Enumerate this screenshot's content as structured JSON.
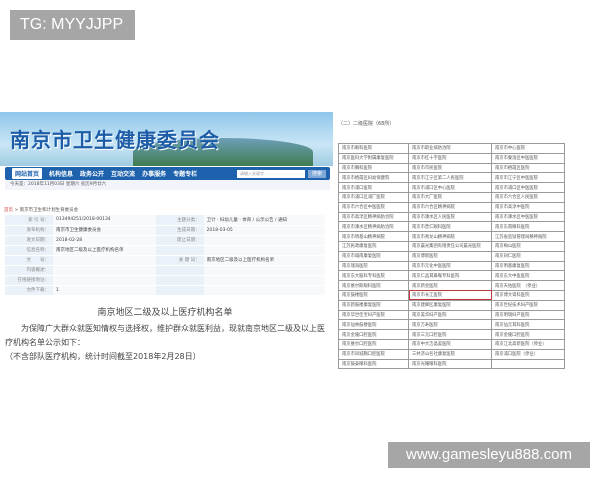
{
  "watermark_top": "TG: MYYJJPP",
  "watermark_bottom": "www.gamesleyu888.com",
  "site": {
    "title": "南京市卫生健康委员会",
    "nav": [
      "网站首页",
      "机构信息",
      "政务公开",
      "互动交流",
      "办事服务",
      "专题专栏"
    ],
    "search_placeholder": "请输入关键字",
    "search_button": "搜索",
    "dateline": "今天是：2018年11月03日  星期六      农历9月廿六",
    "breadcrumb_home": "首页",
    "breadcrumb_sep": ">",
    "breadcrumb_current": "南京市卫生和计划生育委员会",
    "meta": [
      {
        "k1": "索 引 号：",
        "v1": "013494251/2018-00134",
        "k2": "主题分类：",
        "v2": "卫计 · 妇幼儿童 · 体育 / 公示公告 / 通知"
      },
      {
        "k1": "发布机构：",
        "v1": "南京市卫生健康委员会",
        "k2": "生成日期：",
        "v2": "2018-03-05"
      },
      {
        "k1": "发文日期：",
        "v1": "2018-02-28",
        "k2": "废止日期：",
        "v2": ""
      },
      {
        "k1": "信息名称：",
        "v1": "南京地区二级及以上医疗机构名单",
        "k2": "",
        "v2": ""
      },
      {
        "k1": "文　　号：",
        "v1": "",
        "k2": "关 键 词：",
        "v2": "南京地区二级及以上医疗机构名单"
      },
      {
        "k1": "内容概述：",
        "v1": "",
        "k2": "",
        "v2": ""
      },
      {
        "k1": "在线链接地址：",
        "v1": "",
        "k2": "",
        "v2": ""
      },
      {
        "k1": "文件下载：",
        "v1": "1",
        "k2": "",
        "v2": ""
      }
    ],
    "content_title": "南京地区二级及以上医疗机构名单",
    "content_p1": "为保障广大群众就医知情权与选择权，维护群众就医利益，现就南京地区二级及以上医疗机构名单公示如下：",
    "content_p2": "（不含部队医疗机构，统计时间截至2018年2月28日）"
  },
  "hospital_list": {
    "caption": "（二）二级医院（68所）",
    "highlight_color": "#c0383c",
    "rows": [
      [
        "南京市眼科医院",
        "南京市职业病防治院",
        "南京市中心医院"
      ],
      [
        "南京医科大学附属康复医院",
        "南京市红十字医院",
        "南京市秦淮区中医医院"
      ],
      [
        "南京市胸科医院",
        "南京市市民医院",
        "南京市栖霞区医院"
      ],
      [
        "南京市栖霞区妇幼保健院",
        "南京市江宁区第二人民医院",
        "南京市江宁区中医医院"
      ],
      [
        "南京市浦口医院",
        "南京市浦口区中心医院",
        "南京市浦口区中医医院"
      ],
      [
        "南京市浦口区浦厂医院",
        "南京市大厂医院",
        "南京市六合区人民医院"
      ],
      [
        "南京市六合区中医医院",
        "南京市六合区精神病院",
        "南京市高淳中医院"
      ],
      [
        "南京市高淳区精神病防治院",
        "南京市溧水区人民医院",
        "南京市溧水区中医医院"
      ],
      [
        "南京市溧水区精神病防治院",
        "南京市普仁眼科医院",
        "南京东南眼科医院"
      ],
      [
        "南京市明基山精神病院",
        "南京市青龙山精神病院",
        "江苏省监狱管理局精神病院"
      ],
      [
        "江苏民政康复医院",
        "南京晨光集团有限责任公司晨光医院",
        "南京梅山医院"
      ],
      [
        "南京市城南康复医院",
        "南京博新医院",
        "南京同仁医院"
      ],
      [
        "南京瑞海医院",
        "南京市元化中医医院",
        "南京明基康复医院"
      ],
      [
        "南京东大脑科专科医院",
        "南京仁品耳鼻喉专科医院",
        "南京东大中医医院"
      ],
      [
        "南京维尔斯眼科医院",
        "南京新金医院",
        "南京天佑医院　（停业）"
      ],
      [
        "南京鼓楼医院",
        "南京市长江医院",
        "南京博大肾科医院"
      ],
      [
        "南京新鼓楼康复医院",
        "南京建邺区康复医院",
        "南京世纪技术妇产医院"
      ],
      [
        "南京华世佳宝妇产医院",
        "南京美华妇产医院",
        "南京明瑞妇产医院"
      ],
      [
        "南京仙林鼓楼医院",
        "南京万寿医院",
        "南京仙元耳科医院"
      ],
      [
        "南京金陵口腔医院",
        "南京三元口腔医院",
        "南京金陵口腔医院"
      ],
      [
        "南京维尔口腔医院",
        "南京中大洁晶美医院",
        "南京江北高新医院（停业）"
      ],
      [
        "南京市同城胸口腔医院",
        "三共济山名社康复医院",
        "南京浦口医院（停业）"
      ],
      [
        "南京鼓泰眼科医院",
        "南京光耀眼科医院",
        ""
      ]
    ],
    "highlight_cell": [
      15,
      1
    ]
  }
}
